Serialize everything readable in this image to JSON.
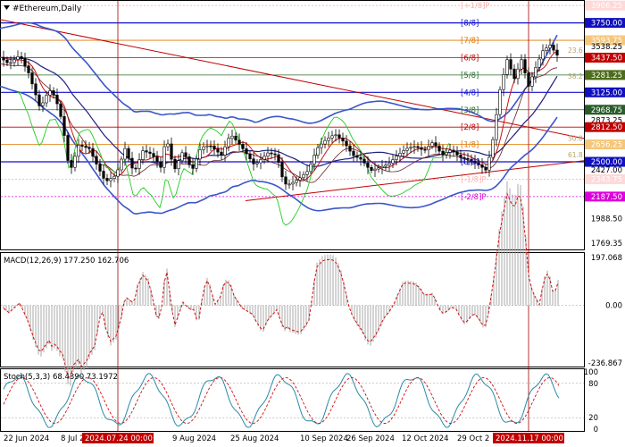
{
  "window": {
    "title": "#Ethereum,Daily"
  },
  "colors": {
    "price_candle": "#000000",
    "ma_fast": "#d01010",
    "ma_slow": "#202080",
    "bollinger": "#3a56c8",
    "signal_line": "#22cc22",
    "cursor_line": "#a00000",
    "trendline": "#c00000",
    "support_line": "#0000aa",
    "murrey_label_blue": "#1010cc",
    "murrey_label_orange": "#e07800",
    "murrey_label_magenta": "#dd00dd"
  },
  "price_axis": {
    "labels": [
      {
        "text": "3906.25",
        "price": 3906.25,
        "bg": "#ffd8d8",
        "fg": "#ffffff"
      },
      {
        "text": "3750.00",
        "price": 3750.0,
        "bg": "#1010c0",
        "fg": "#ffffff"
      },
      {
        "text": "3593.75",
        "price": 3593.75,
        "bg": "#f5c67a",
        "fg": "#ffffff"
      },
      {
        "text": "3538.25",
        "price": 3538.25,
        "bg": "",
        "fg": "#000000"
      },
      {
        "text": "3437.50",
        "price": 3437.5,
        "bg": "#c00000",
        "fg": "#ffffff"
      },
      {
        "text": "3281.25",
        "price": 3281.25,
        "bg": "#4d6b1a",
        "fg": "#ffffff"
      },
      {
        "text": "3125.00",
        "price": 3125.0,
        "bg": "#1010c0",
        "fg": "#ffffff"
      },
      {
        "text": "2968.75",
        "price": 2968.75,
        "bg": "#2a5c2a",
        "fg": "#ffffff"
      },
      {
        "text": "2873.25",
        "price": 2873.25,
        "bg": "",
        "fg": "#000000"
      },
      {
        "text": "2812.50",
        "price": 2812.5,
        "bg": "#c00000",
        "fg": "#ffffff"
      },
      {
        "text": "2656.25",
        "price": 2656.25,
        "bg": "#f5c67a",
        "fg": "#ffffff"
      },
      {
        "text": "2500.00",
        "price": 2500.0,
        "bg": "#1010c0",
        "fg": "#ffffff"
      },
      {
        "text": "2427.00",
        "price": 2427.0,
        "bg": "",
        "fg": "#000000"
      },
      {
        "text": "2343.75",
        "price": 2343.75,
        "bg": "#ffd8d8",
        "fg": "#ffffff"
      },
      {
        "text": "2187.50",
        "price": 2187.5,
        "bg": "#dd00dd",
        "fg": "#ffffff"
      },
      {
        "text": "1988.50",
        "price": 1988.5,
        "bg": "",
        "fg": "#000000"
      },
      {
        "text": "1769.35",
        "price": 1769.35,
        "bg": "",
        "fg": "#000000"
      }
    ],
    "min": 1720,
    "max": 3940
  },
  "murrey_levels": [
    {
      "label": "[+1/8]P",
      "price": 3906.25,
      "color": "#ffb0b0"
    },
    {
      "label": "[8/8]",
      "price": 3750.0,
      "color": "#1010cc"
    },
    {
      "label": "[7/8]",
      "price": 3593.75,
      "color": "#e07800"
    },
    {
      "label": "[6/8]",
      "price": 3437.5,
      "color": "#c00000"
    },
    {
      "label": "[5/8]",
      "price": 3281.25,
      "color": "#2a6a2a"
    },
    {
      "label": "[4/8]",
      "price": 3125.0,
      "color": "#1010cc"
    },
    {
      "label": "[3/8]",
      "price": 2968.75,
      "color": "#2a6a2a"
    },
    {
      "label": "[2/8]",
      "price": 2812.5,
      "color": "#c00000"
    },
    {
      "label": "[1/8]",
      "price": 2656.25,
      "color": "#e07800"
    },
    {
      "label": "[0/8]",
      "price": 2500.0,
      "color": "#1010cc"
    },
    {
      "label": "[-1/8]P",
      "price": 2343.75,
      "color": "#ffb0b0"
    },
    {
      "label": "[-2/8]P",
      "price": 2187.5,
      "color": "#dd00dd"
    }
  ],
  "fib_labels": [
    {
      "text": "23.6",
      "price": 3480
    },
    {
      "text": "38.2",
      "price": 3250
    },
    {
      "text": "50.0",
      "price": 2690
    },
    {
      "text": "61.8",
      "price": 2540
    }
  ],
  "time_axis": {
    "labels": [
      "22 Jun 2024",
      "8 Jul 2",
      "9 Aug 2024",
      "25 Aug 2024",
      "10 Sep 2024",
      "26 Sep 2024",
      "12 Oct 2024",
      "29 Oct 2"
    ],
    "cursor_labels": [
      "2024.07.24 00:00",
      "2024.11.17 00:00"
    ]
  },
  "macd": {
    "title": "MACD(12,26,9) 177.250 162.706",
    "axis_labels": [
      "197.068",
      "0.00",
      "-236.867"
    ]
  },
  "stoch": {
    "title": "Stoch(5,3,3) 68.4390 73.1972",
    "axis_labels": [
      "100",
      "80",
      "20",
      "0"
    ]
  }
}
